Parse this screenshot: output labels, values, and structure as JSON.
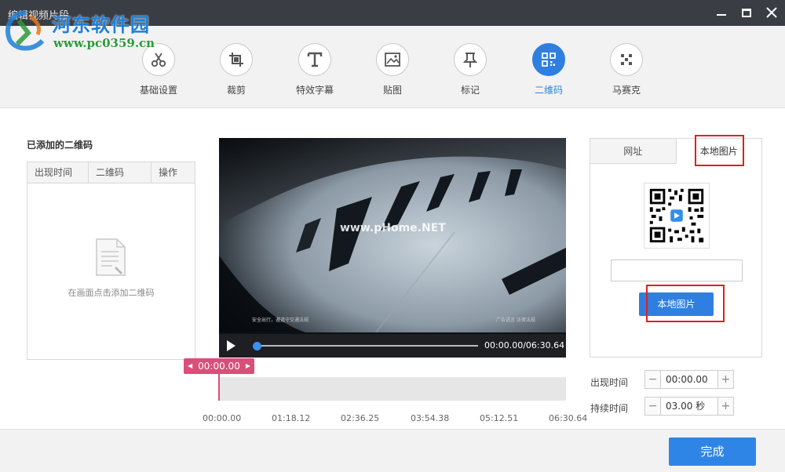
{
  "window": {
    "title": "编辑视频片段",
    "controls": [
      "minimize",
      "maximize",
      "close"
    ]
  },
  "watermark": {
    "site_name": "河东软件园",
    "url": "www.pc0359.cn"
  },
  "toolbar": {
    "tools": [
      {
        "label": "基础设置",
        "icon": "scissors-icon"
      },
      {
        "label": "裁剪",
        "icon": "crop-icon"
      },
      {
        "label": "特效字幕",
        "icon": "text-icon"
      },
      {
        "label": "贴图",
        "icon": "image-icon"
      },
      {
        "label": "标记",
        "icon": "pin-icon"
      },
      {
        "label": "二维码",
        "icon": "qrcode-icon",
        "active": true
      },
      {
        "label": "马赛克",
        "icon": "mosaic-icon"
      }
    ]
  },
  "left_panel": {
    "title": "已添加的二维码",
    "columns": [
      "出现时间",
      "二维码",
      "操作"
    ],
    "empty_text": "在画面点击添加二维码"
  },
  "video": {
    "watermark_text": "www.pHome.NET",
    "subtitle_left": "安全出行，遵道守交通法规",
    "subtitle_right": "广告语言 法律法规",
    "current_time": "00:00.00",
    "total_time": "06:30.64",
    "time_display": "00:00.00/06:30.64",
    "progress": 0
  },
  "timeline": {
    "marker_time": "00:00.00",
    "ticks": [
      "00:00.00",
      "01:18.12",
      "02:36.25",
      "03:54.38",
      "05:12.51",
      "06:30.64"
    ]
  },
  "right_panel": {
    "tabs": [
      "网址",
      "本地图片"
    ],
    "active_tab": "本地图片",
    "path_value": "",
    "local_image_button": "本地图片"
  },
  "settings": {
    "appear_label": "出现时间",
    "appear_value": "00:00.00",
    "duration_label": "持续时间",
    "duration_value": "03.00 秒"
  },
  "footer": {
    "done_label": "完成"
  },
  "colors": {
    "accent": "#2f7fe0",
    "titlebar": "#3a3d44",
    "marker": "#d94f7a",
    "highlight_box": "#e02020"
  }
}
